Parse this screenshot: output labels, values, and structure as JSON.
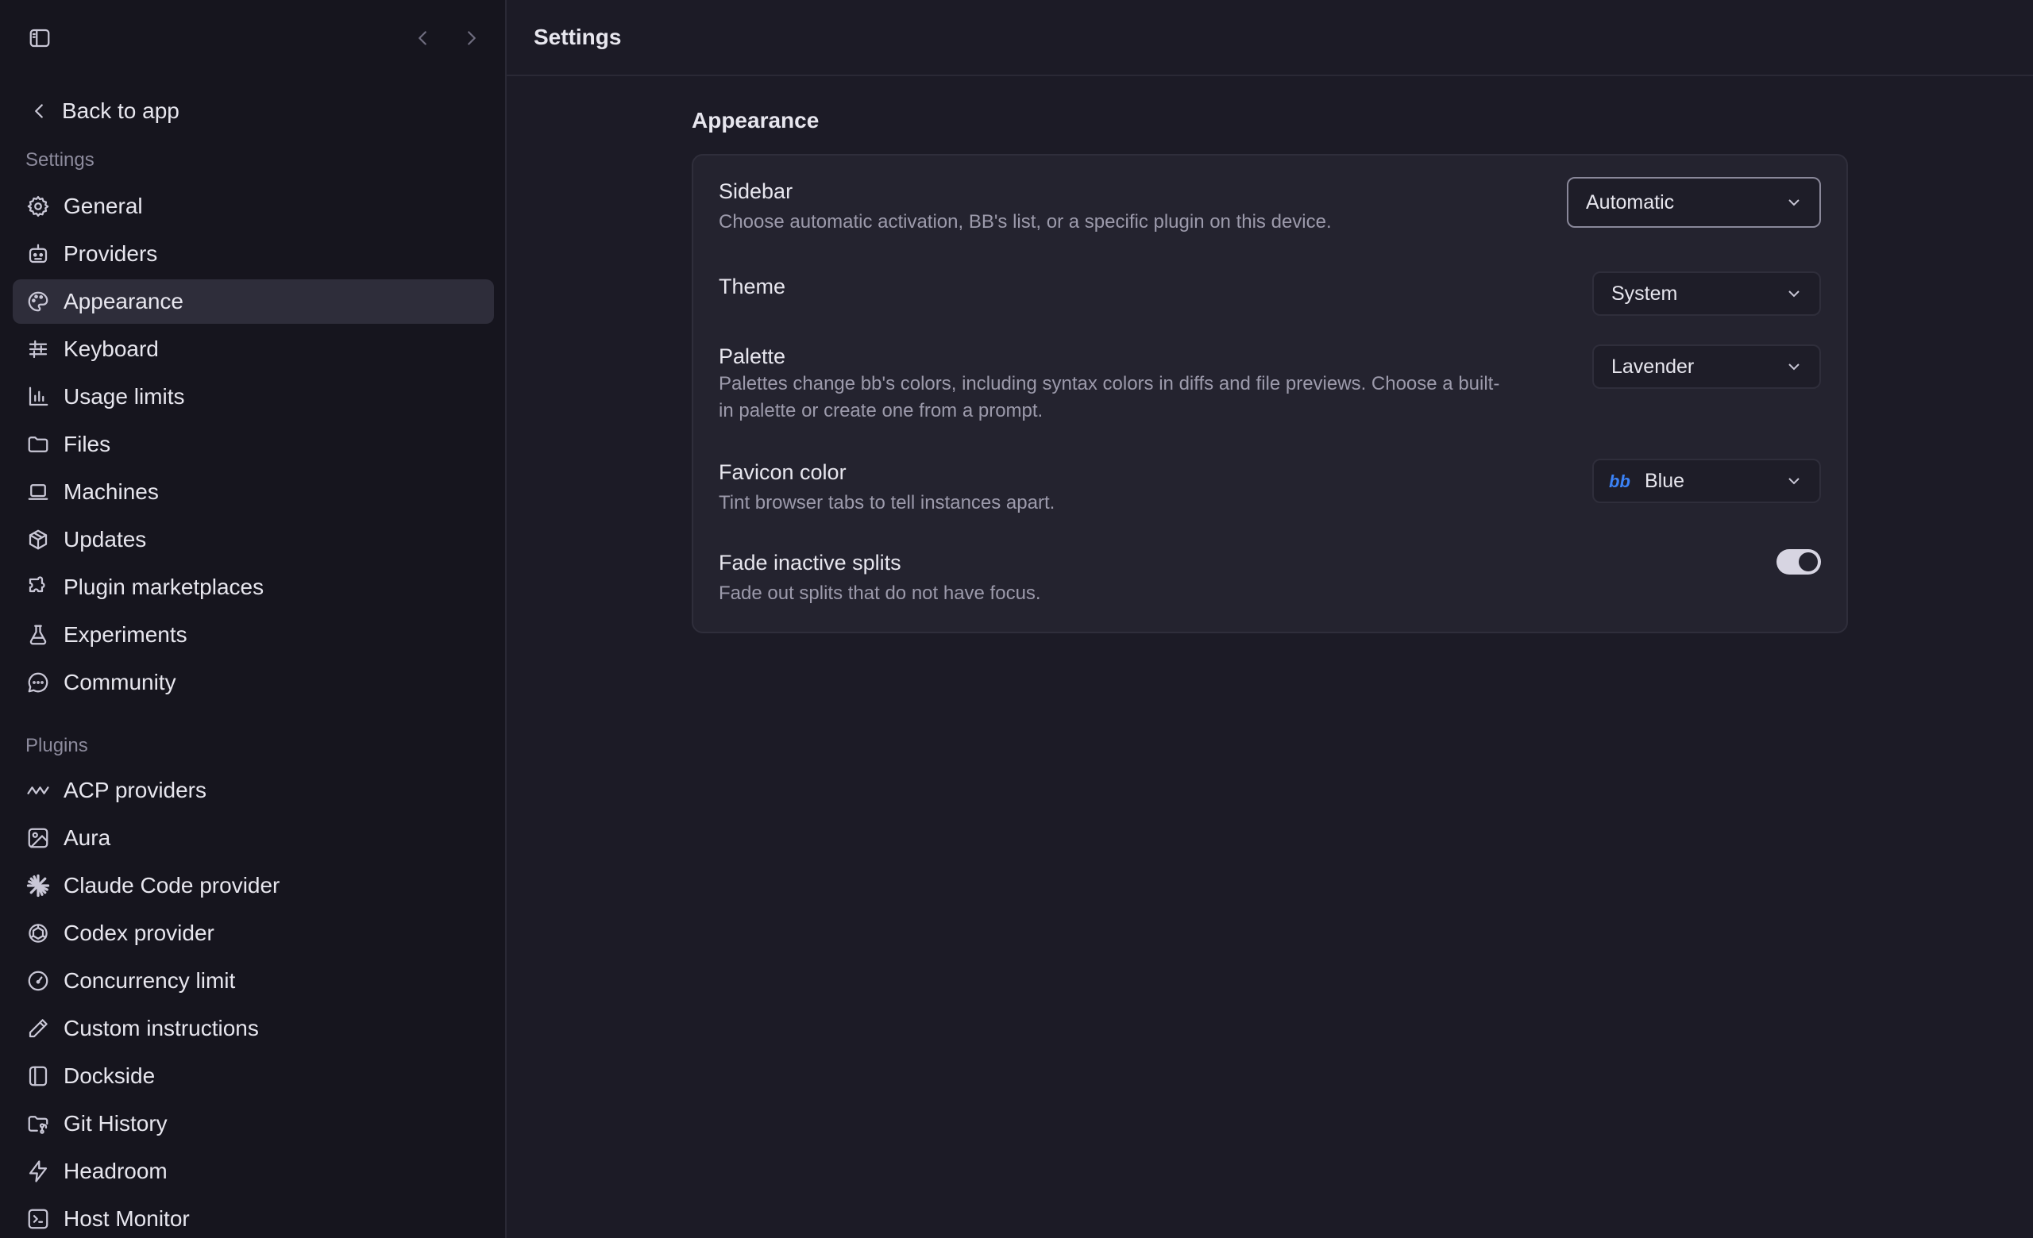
{
  "header": {
    "title": "Settings"
  },
  "sidebar": {
    "back_label": "Back to app",
    "settings_section": "Settings",
    "settings_items": [
      {
        "label": "General",
        "icon": "gear-icon"
      },
      {
        "label": "Providers",
        "icon": "robot-icon"
      },
      {
        "label": "Appearance",
        "icon": "palette-icon",
        "active": true
      },
      {
        "label": "Keyboard",
        "icon": "sliders-icon"
      },
      {
        "label": "Usage limits",
        "icon": "bar-chart-icon"
      },
      {
        "label": "Files",
        "icon": "folder-icon"
      },
      {
        "label": "Machines",
        "icon": "laptop-icon"
      },
      {
        "label": "Updates",
        "icon": "package-icon"
      },
      {
        "label": "Plugin marketplaces",
        "icon": "puzzle-icon"
      },
      {
        "label": "Experiments",
        "icon": "flask-icon"
      },
      {
        "label": "Community",
        "icon": "chat-bubble-icon"
      }
    ],
    "plugins_section": "Plugins",
    "plugin_items": [
      {
        "label": "ACP providers",
        "icon": "wave-icon"
      },
      {
        "label": "Aura",
        "icon": "image-icon"
      },
      {
        "label": "Claude Code provider",
        "icon": "starburst-icon"
      },
      {
        "label": "Codex provider",
        "icon": "openai-knot-icon"
      },
      {
        "label": "Concurrency limit",
        "icon": "gauge-icon"
      },
      {
        "label": "Custom instructions",
        "icon": "pencil-icon"
      },
      {
        "label": "Dockside",
        "icon": "panel-left-icon"
      },
      {
        "label": "Git History",
        "icon": "folder-git-icon"
      },
      {
        "label": "Headroom",
        "icon": "lightning-icon"
      },
      {
        "label": "Host Monitor",
        "icon": "terminal-square-icon"
      }
    ]
  },
  "appearance": {
    "title": "Appearance",
    "sidebar_row": {
      "title": "Sidebar",
      "desc": "Choose automatic activation, BB's list, or a specific plugin on this device.",
      "value": "Automatic"
    },
    "theme_row": {
      "title": "Theme",
      "value": "System"
    },
    "palette_row": {
      "title": "Palette",
      "desc_line1": "Palettes change bb's colors, including syntax colors in diffs and file previews. Choose a built-",
      "desc_line2": "in palette or create one from a prompt.",
      "value": "Lavender"
    },
    "favicon_row": {
      "title": "Favicon color",
      "desc": "Tint browser tabs to tell instances apart.",
      "value": "Blue",
      "favicon_color": "#3b82f6",
      "favicon_glyph": "bb"
    },
    "fade_row": {
      "title": "Fade inactive splits",
      "desc": "Fade out splits that do not have focus.",
      "enabled": true
    }
  }
}
